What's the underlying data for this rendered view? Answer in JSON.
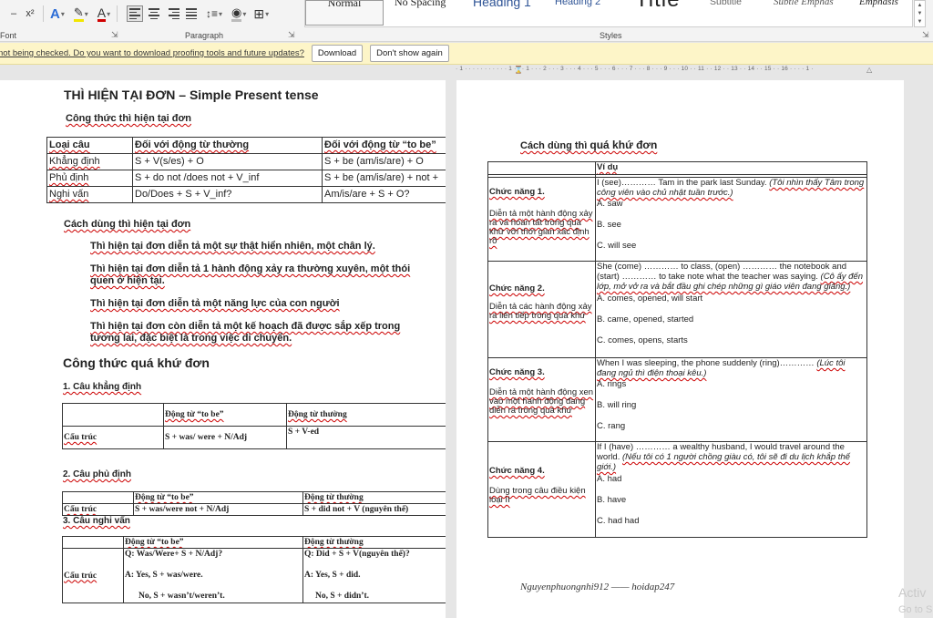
{
  "ribbon": {
    "font_group_label": "Font",
    "paragraph_group_label": "Paragraph",
    "styles_group_label": "Styles",
    "styles": [
      "Normal",
      "No Spacing",
      "Heading 1",
      "Heading 2",
      "Title",
      "Subtitle",
      "Subtle Emphas",
      "Emphasis"
    ],
    "font_tools": [
      "x²",
      "A",
      "✎",
      "A"
    ],
    "accent_colors": {
      "text_effect": "#2b6cd6",
      "highlight": "#f2e600",
      "font_color": "#d00000",
      "heading_color": "#2f5496"
    }
  },
  "message_bar": {
    "text": "not being checked. Do you want to download proofing tools and future updates?",
    "download_label": "Download",
    "dont_show_label": "Don't show again"
  },
  "ruler": {
    "text": "· 1 · · · · · · · · · · · 1 · · · 1 · · · 2 · · · 3 · · · 4 · · · 5 · · · 6 · · · 7 · · · 8 · · · 9 · · · 10 · · 11 · · 12 · · 13 · · 14 · · 15 · · 16 · · · · 1 ·"
  },
  "left_page": {
    "title": "THÌ HIỆN TẠI ĐƠN – Simple Present tense",
    "formula_heading": "Công thức thì hiện tại đơn",
    "present_table": {
      "headers": [
        "Loại câu",
        "Đối với động từ thường",
        "Đối với động từ “to be”"
      ],
      "rows": [
        [
          "Khẳng định",
          "S + V(s/es) + O",
          "S + be (am/is/are) + O"
        ],
        [
          "Phủ định",
          "S + do not /does not + V_inf",
          "S + be (am/is/are) + not +"
        ],
        [
          "Nghi vấn",
          "Do/Does + S + V_inf?",
          "Am/is/are + S + O?"
        ]
      ]
    },
    "usage_heading": "Cách dùng thì hiện tại đơn",
    "usage": [
      "Thì hiện tại đơn diễn tả một sự thật hiển nhiên, một chân lý.",
      "Thì hiện tại đơn diễn tả 1 hành động xảy ra thường xuyên, một thói quen ở hiện tại.",
      "Thì hiện tại đơn diễn tả một năng lực của con người",
      "Thì hiện tại đơn còn diễn tả một kế hoạch đã được sắp xếp trong tương lai, đặc biệt là trong việc di chuyển."
    ],
    "past_heading": "Công thức quá khứ đơn",
    "affirm_heading": "1. Câu khẳng định",
    "affirm_table": {
      "headers": [
        "",
        "Động từ “to be”",
        "Động từ thường"
      ],
      "row": [
        "Cấu trúc",
        "S + was/ were + N/Adj",
        "S + V-ed"
      ]
    },
    "neg_heading": "2. Câu phủ định",
    "neg_table": {
      "headers": [
        "",
        "Động từ “to be”",
        "Động từ thường"
      ],
      "row": [
        "Cấu trúc",
        "S + was/were not + N/Adj",
        "S + did not + V (nguyên thể)"
      ]
    },
    "q_heading": "3. Câu nghi vấn",
    "q_table": {
      "headers": [
        "",
        "Động từ “to be”",
        "Động từ thường"
      ],
      "label": "Cấu trúc",
      "tobe_lines": [
        "Q: Was/Were+ S + N/Adj?",
        "A: Yes, S + was/were.",
        "No, S + wasn’t/weren’t."
      ],
      "verb_lines": [
        "Q: Did + S + V(nguyên thể)?",
        "A: Yes, S + did.",
        "No, S + didn’t."
      ]
    }
  },
  "right_page": {
    "heading_prefix": "Cách dùng thì ",
    "heading_bold": "quá khứ đơn",
    "example_header": "Ví dụ",
    "functions": [
      {
        "name": "Chức năng 1.",
        "desc": "Diễn tả một hành động xảy ra và hoàn tất trong quá khứ với thời gian xác định rõ",
        "question": "I (see)………… Tam in the park last Sunday.",
        "translation": "(Tôi nhìn thấy Tâm trong công viên vào chủ nhật tuần trước.)",
        "options": [
          "A. saw",
          "B. see",
          "C. will see"
        ]
      },
      {
        "name": "Chức năng 2.",
        "desc": "Diễn tả các hành động xảy ra liên tiếp trong quá khứ",
        "question": "She (come) ………… to class, (open) ………… the notebook and (start) ………… to take note what the teacher was saying.",
        "translation": "(Cô ấy đến lớp, mở vở ra và bắt đầu ghi chép những gì giáo viên đang giảng.)",
        "options": [
          "A. comes, opened, will start",
          "B. came, opened, started",
          "C. comes, opens, starts"
        ]
      },
      {
        "name": "Chức năng 3.",
        "desc": "Diễn tả một hành động xen vào một hành động đang diễn ra trong quá khứ",
        "question": "When I was sleeping, the phone suddenly (ring)…………",
        "translation": "(Lúc tôi đang ngủ thì điện thoại kêu.)",
        "options": [
          "A. rings",
          "B. will ring",
          "C. rang"
        ]
      },
      {
        "name": "Chức năng 4.",
        "desc": "Dùng trong câu điều kiện loại II",
        "question": "If I (have) ………… a wealthy husband, I would travel around the world.",
        "translation": "(Nếu tôi có 1 người chồng giàu có, tôi sẽ đi du lịch khắp thế giới.)",
        "options": [
          "A. had",
          "B. have",
          "C. had had"
        ]
      }
    ],
    "signature": "Nguyenphuongnhi912 —— hoidap247"
  },
  "watermark": {
    "line1": "Activ",
    "line2": "Go to S"
  }
}
